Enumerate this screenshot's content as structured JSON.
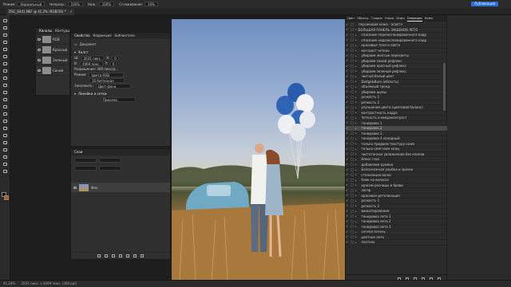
{
  "optbar": {
    "mode_label": "Режим:",
    "mode_value": "Нормальный",
    "opacity_label": "Непрозр.:",
    "opacity_value": "100%",
    "pressure_label": "Наж.:",
    "pressure_value": "100%",
    "smoothing_label": "Сглаживание:",
    "smoothing_value": "10%",
    "share_label": "Публикация"
  },
  "doc_tab": {
    "title": "DSC_6441.NEF @ 41,2% (RGB/16) *",
    "close": "×"
  },
  "toolbar": {
    "fg_color": "#0d0d0d",
    "bg_color": "#c0521f"
  },
  "channels": {
    "tabs": [
      "Каналы",
      "Контуры"
    ],
    "items": [
      "RGB",
      "Красный",
      "Зеленый",
      "Синий"
    ]
  },
  "properties": {
    "tabs": [
      "Свойства",
      "Коррекция",
      "Библиотеки"
    ],
    "doc_label": "Документ",
    "canvas_section": "Холст",
    "width_label": "Ш:",
    "width_value": "2631 пикс.",
    "height_label": "В:",
    "height_value": "4069 пикс.",
    "x_label": "X:",
    "y_label": "Y:",
    "x_value": "0",
    "y_value": "0",
    "resolution": "Разрешение: 300 пикс/д...",
    "mode_label": "Режим:",
    "mode_value": "Цвета RGB",
    "depth_value": "16 бит/канал",
    "fill_label": "Заполнить:",
    "fill_value": "Цвет фона",
    "guides_section": "Линейки и сетки",
    "units_value": "Пиксели"
  },
  "layers": {
    "tabs": [
      "Слои"
    ],
    "background_name": "Фон"
  },
  "right_panel": {
    "tabs": [
      "Цвет",
      "Образц.",
      "Градие",
      "Узоры",
      "Инфо",
      "Операции",
      "Комм"
    ],
    "active_tab": "Операции",
    "actions": [
      {
        "label": "персиковая кожа - осветл",
        "arrow": false
      },
      {
        "label": "БОЛЬШАЯ ПАНЕЛЬ ЭКШЕНОВ ЛЕТО",
        "arrow": true,
        "set": true
      },
      {
        "label": "спасение переэкспонированного кадр",
        "arrow": true
      },
      {
        "label": "спасение недоэкспонированного кадр",
        "arrow": true
      },
      {
        "label": "красивые тени и света",
        "arrow": true
      },
      {
        "label": "контраст четкое",
        "arrow": true
      },
      {
        "label": "убираем желтые пересветы",
        "arrow": true
      },
      {
        "label": "убираем синий рефлекс",
        "arrow": true
      },
      {
        "label": "убираем красный рефлекс",
        "arrow": true
      },
      {
        "label": "убираем зеленый рефлекс",
        "arrow": true
      },
      {
        "label": "чистый белый цвет",
        "arrow": true
      },
      {
        "label": "Dodge&Burn (область)",
        "arrow": true
      },
      {
        "label": "объемный тренд",
        "arrow": true
      },
      {
        "label": "убираем шумы",
        "arrow": true
      },
      {
        "label": "резкость 1",
        "arrow": true
      },
      {
        "label": "резкость 2",
        "arrow": true
      },
      {
        "label": "улучшение цвета (цветовой баланс)",
        "arrow": true
      },
      {
        "label": "контрастность кадра",
        "arrow": true
      },
      {
        "label": "Четкость и микроконтраст",
        "arrow": true
      },
      {
        "label": "тонировка 1",
        "arrow": true
      },
      {
        "label": "тонировка 2",
        "arrow": true,
        "selected": true
      },
      {
        "label": "тонировка 3",
        "arrow": true
      },
      {
        "label": "тонировка 4 холодный",
        "arrow": true
      },
      {
        "label": "только придаем текстуру коже",
        "arrow": true
      },
      {
        "label": "только смягчаем кожу",
        "arrow": true
      },
      {
        "label": "чистотонное увлажнение без клипов",
        "arrow": true
      },
      {
        "label": "блеск глаз",
        "arrow": true
      },
      {
        "label": "добавляем румяна",
        "arrow": true
      },
      {
        "label": "Белоснежная улыбка и зрачки",
        "arrow": true
      },
      {
        "label": "стилизация волос",
        "arrow": true
      },
      {
        "label": "блик на волосах",
        "arrow": true
      },
      {
        "label": "красим ресницы и брови",
        "arrow": true
      },
      {
        "label": "загар",
        "arrow": true
      },
      {
        "label": "красивая детализация",
        "arrow": true
      },
      {
        "label": "резкость 1",
        "arrow": true
      },
      {
        "label": "резкость 2",
        "arrow": true
      },
      {
        "label": "виньетирование",
        "arrow": true
      },
      {
        "label": "тонировка лето 1",
        "arrow": true
      },
      {
        "label": "тонировка лето 2",
        "arrow": true
      },
      {
        "label": "тонировка лето 3",
        "arrow": true
      },
      {
        "label": "сочная зелень",
        "arrow": true
      },
      {
        "label": "цветное лето",
        "arrow": true
      },
      {
        "label": "пастель",
        "arrow": true
      }
    ]
  },
  "status": {
    "zoom": "41,24%",
    "doc_info": "2631 пикс. x 4069 пикс. (300 ppi)"
  }
}
